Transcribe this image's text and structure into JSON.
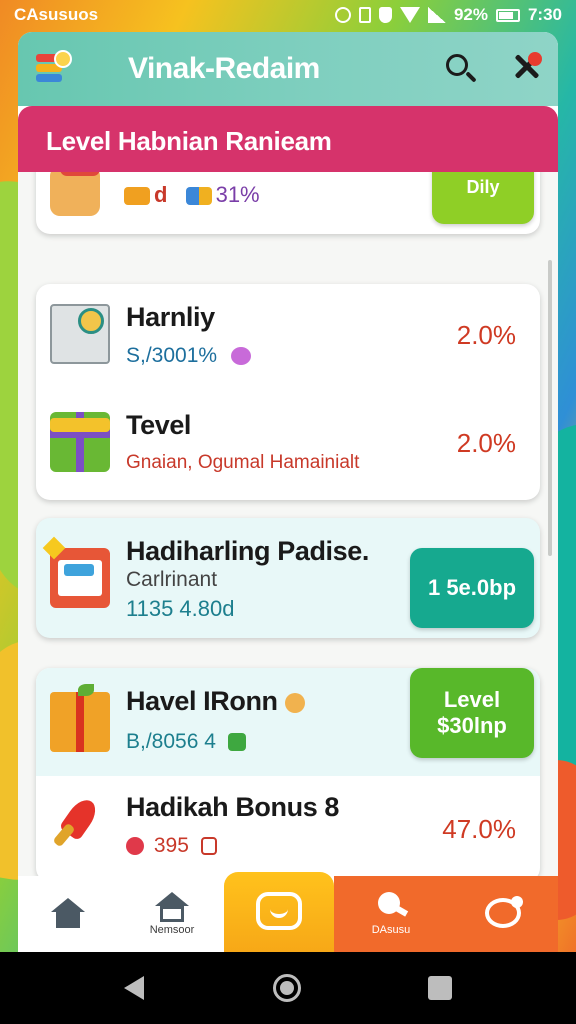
{
  "status_bar": {
    "carrier": "CAsusuos",
    "battery": "92%",
    "time": "7:30"
  },
  "app": {
    "title": "Vinak-Redaim"
  },
  "banner": {
    "title": "Level Habnian Ranieam"
  },
  "top_partial": {
    "text_a": "d",
    "text_b": "31%",
    "button_label": "Dily"
  },
  "items": [
    {
      "title": "Harnliy",
      "subtitle": "S,/3001%",
      "value": "2.0%"
    },
    {
      "title": "Tevel",
      "subtitle": "Gnaian, Ogumal Hamainialt",
      "value": "2.0%"
    },
    {
      "title": "Hadiharling Padise.",
      "subtitle": "Carlrinant",
      "subtitle2": "1135 4.80d",
      "button_label": "1 5e.0bp"
    },
    {
      "title": "Havel IRonn",
      "subtitle": "B,/8056 4",
      "button_label_1": "Level",
      "button_label_2": "$30lnp"
    },
    {
      "title": "Hadikah Bonus 8",
      "subtitle": "395",
      "value": "47.0%"
    }
  ],
  "nav": [
    {
      "label": ""
    },
    {
      "label": "Nemsoor"
    },
    {
      "label": ""
    },
    {
      "label": "DAsusu"
    },
    {
      "label": ""
    }
  ],
  "colors": {
    "appbar": "#7fcfbf",
    "banner": "#d6336b",
    "accent_teal": "#16a98f",
    "accent_green": "#58b82a",
    "accent_orange": "#f16a2b",
    "accent_yellow": "#ffc21c",
    "value_red": "#cf3a23"
  }
}
